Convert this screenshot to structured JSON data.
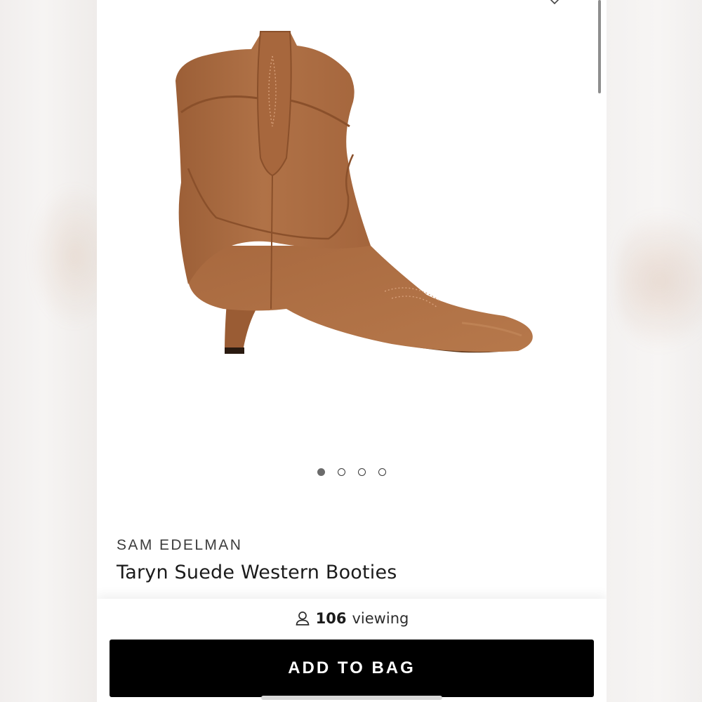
{
  "product": {
    "brand": "SAM EDELMAN",
    "name": "Taryn Suede Western Booties",
    "image_alt": "Brown suede western kitten-heel bootie",
    "color": "#a9683e"
  },
  "gallery": {
    "total_images": 4,
    "active_index": 0
  },
  "social_proof": {
    "count": "106",
    "label": "viewing",
    "icon": "person-icon"
  },
  "actions": {
    "add_to_bag_label": "ADD TO BAG"
  },
  "colors": {
    "button_bg": "#000000",
    "button_text": "#ffffff",
    "accent_shoe": "#a9683e"
  }
}
